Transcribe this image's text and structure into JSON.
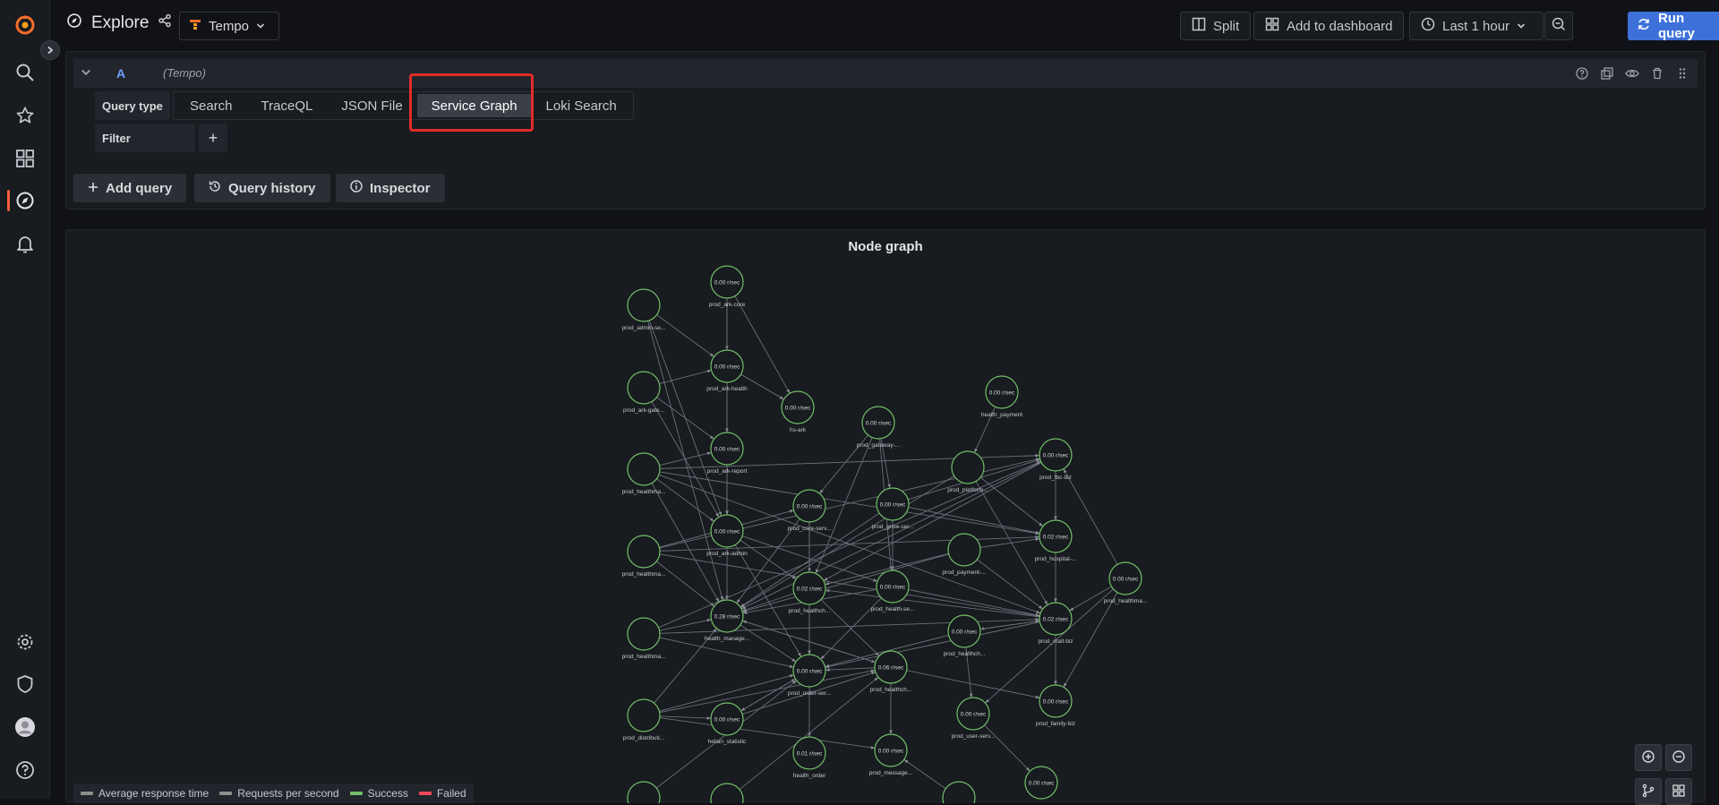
{
  "topbar": {
    "title": "Explore",
    "datasource": "Tempo",
    "split_label": "Split",
    "add_dashboard_label": "Add to dashboard",
    "time_range": "Last 1 hour",
    "run_query_label": "Run query"
  },
  "query": {
    "ref_id": "A",
    "datasource_hint": "(Tempo)",
    "query_type_label": "Query type",
    "query_types": [
      "Search",
      "TraceQL",
      "JSON File",
      "Service Graph",
      "Loki Search"
    ],
    "selected_query_type": "Service Graph",
    "filter_label": "Filter",
    "filter_add": "+",
    "buttons": {
      "add_query": "Add query",
      "query_history": "Query history",
      "inspector": "Inspector"
    }
  },
  "graph": {
    "title": "Node graph",
    "legend": [
      {
        "label": "Average response time",
        "color": "#8e8e8e"
      },
      {
        "label": "Requests per second",
        "color": "#8e8e8e"
      },
      {
        "label": "Success",
        "color": "#73bf69"
      },
      {
        "label": "Failed",
        "color": "#f2495c"
      }
    ],
    "nodes": [
      {
        "id": "n1",
        "value": "",
        "label": "prod_admin-se..."
      },
      {
        "id": "n2",
        "value": "0.00 r/sec",
        "label": "prod_ark-core"
      },
      {
        "id": "n3",
        "value": "",
        "label": "prod_ark-gate..."
      },
      {
        "id": "n4",
        "value": "0.00 r/sec",
        "label": "prod_ark-health"
      },
      {
        "id": "n5",
        "value": "0.00 r/sec",
        "label": "hs-ark"
      },
      {
        "id": "n6",
        "value": "0.00 r/sec",
        "label": "health_payment"
      },
      {
        "id": "n7",
        "value": "0.00 r/sec",
        "label": "prod_gateway-..."
      },
      {
        "id": "n8",
        "value": "0.00 r/sec",
        "label": "prod_ark-report"
      },
      {
        "id": "n9",
        "value": "",
        "label": "prod_healthma..."
      },
      {
        "id": "n10",
        "value": "",
        "label": "prod_platform..."
      },
      {
        "id": "n11",
        "value": "0.00 r/sec",
        "label": "prod_fbc-biz"
      },
      {
        "id": "n12",
        "value": "0.00 r/sec",
        "label": "prod_core-serv..."
      },
      {
        "id": "n13",
        "value": "0.00 r/sec",
        "label": "prod_grow-ser..."
      },
      {
        "id": "n14",
        "value": "0.00 r/sec",
        "label": "prod_ark-admin"
      },
      {
        "id": "n15",
        "value": "",
        "label": "prod_healthma..."
      },
      {
        "id": "n16",
        "value": "",
        "label": "prod_payment-..."
      },
      {
        "id": "n17",
        "value": "0.02 r/sec",
        "label": "prod_hospital-..."
      },
      {
        "id": "n18",
        "value": "0.00 r/sec",
        "label": "prod_healthma..."
      },
      {
        "id": "n19",
        "value": "0.02 r/sec",
        "label": "prod_healthch..."
      },
      {
        "id": "n20",
        "value": "0.00 r/sec",
        "label": "prod_health-se..."
      },
      {
        "id": "n21",
        "value": "0.28 r/sec",
        "label": "health_manage..."
      },
      {
        "id": "n22",
        "value": "0.02 r/sec",
        "label": "prod_mall-biz"
      },
      {
        "id": "n23",
        "value": "",
        "label": "prod_healthma..."
      },
      {
        "id": "n24",
        "value": "0.00 r/sec",
        "label": "prod_healthch..."
      },
      {
        "id": "n25",
        "value": "0.00 r/sec",
        "label": "prod_order-ser..."
      },
      {
        "id": "n26",
        "value": "0.06 r/sec",
        "label": "prod_healthch..."
      },
      {
        "id": "n27",
        "value": "0.00 r/sec",
        "label": "prod_family-biz"
      },
      {
        "id": "n28",
        "value": "",
        "label": "prod_distributi..."
      },
      {
        "id": "n29",
        "value": "0.00 r/sec",
        "label": "helian_statistic"
      },
      {
        "id": "n30",
        "value": "0.00 r/sec",
        "label": "prod_user-serv..."
      },
      {
        "id": "n31",
        "value": "0.01 r/sec",
        "label": "health_order"
      },
      {
        "id": "n32",
        "value": "0.00 r/sec",
        "label": "prod_message..."
      },
      {
        "id": "n33",
        "value": "0.00 r/sec",
        "label": ""
      },
      {
        "id": "n34",
        "value": "",
        "label": ""
      },
      {
        "id": "n35",
        "value": "",
        "label": ""
      },
      {
        "id": "n36",
        "value": "",
        "label": ""
      }
    ],
    "edges": [
      [
        "n1",
        "n4"
      ],
      [
        "n1",
        "n14"
      ],
      [
        "n1",
        "n21"
      ],
      [
        "n2",
        "n4"
      ],
      [
        "n2",
        "n5"
      ],
      [
        "n2",
        "n14"
      ],
      [
        "n3",
        "n4"
      ],
      [
        "n3",
        "n8"
      ],
      [
        "n3",
        "n14"
      ],
      [
        "n4",
        "n5"
      ],
      [
        "n4",
        "n8"
      ],
      [
        "n8",
        "n14"
      ],
      [
        "n9",
        "n8"
      ],
      [
        "n9",
        "n14"
      ],
      [
        "n9",
        "n11"
      ],
      [
        "n9",
        "n17"
      ],
      [
        "n9",
        "n21"
      ],
      [
        "n9",
        "n22"
      ],
      [
        "n7",
        "n12"
      ],
      [
        "n7",
        "n13"
      ],
      [
        "n7",
        "n20"
      ],
      [
        "n7",
        "n19"
      ],
      [
        "n6",
        "n10"
      ],
      [
        "n10",
        "n17"
      ],
      [
        "n10",
        "n22"
      ],
      [
        "n10",
        "n21"
      ],
      [
        "n11",
        "n17"
      ],
      [
        "n11",
        "n21"
      ],
      [
        "n12",
        "n19"
      ],
      [
        "n12",
        "n21"
      ],
      [
        "n12",
        "n25"
      ],
      [
        "n13",
        "n11"
      ],
      [
        "n13",
        "n20"
      ],
      [
        "n13",
        "n21"
      ],
      [
        "n13",
        "n17"
      ],
      [
        "n14",
        "n19"
      ],
      [
        "n14",
        "n21"
      ],
      [
        "n14",
        "n25"
      ],
      [
        "n14",
        "n20"
      ],
      [
        "n15",
        "n12"
      ],
      [
        "n15",
        "n17"
      ],
      [
        "n15",
        "n21"
      ],
      [
        "n15",
        "n22"
      ],
      [
        "n15",
        "n11"
      ],
      [
        "n16",
        "n21"
      ],
      [
        "n16",
        "n17"
      ],
      [
        "n16",
        "n22"
      ],
      [
        "n16",
        "n19"
      ],
      [
        "n17",
        "n22"
      ],
      [
        "n18",
        "n22"
      ],
      [
        "n18",
        "n11"
      ],
      [
        "n18",
        "n30"
      ],
      [
        "n19",
        "n25"
      ],
      [
        "n19",
        "n21"
      ],
      [
        "n19",
        "n26"
      ],
      [
        "n20",
        "n22"
      ],
      [
        "n20",
        "n25"
      ],
      [
        "n20",
        "n21"
      ],
      [
        "n21",
        "n25"
      ],
      [
        "n21",
        "n26"
      ],
      [
        "n22",
        "n27"
      ],
      [
        "n22",
        "n24"
      ],
      [
        "n22",
        "n25"
      ],
      [
        "n22",
        "n19"
      ],
      [
        "n23",
        "n21"
      ],
      [
        "n23",
        "n25"
      ],
      [
        "n23",
        "n22"
      ],
      [
        "n23",
        "n11"
      ],
      [
        "n24",
        "n25"
      ],
      [
        "n24",
        "n30"
      ],
      [
        "n24",
        "n22"
      ],
      [
        "n26",
        "n25"
      ],
      [
        "n26",
        "n32"
      ],
      [
        "n26",
        "n27"
      ],
      [
        "n26",
        "n21"
      ],
      [
        "n28",
        "n21"
      ],
      [
        "n28",
        "n29"
      ],
      [
        "n28",
        "n25"
      ],
      [
        "n28",
        "n26"
      ],
      [
        "n28",
        "n32"
      ],
      [
        "n29",
        "n25"
      ],
      [
        "n29",
        "n26"
      ],
      [
        "n30",
        "n33"
      ],
      [
        "n25",
        "n31"
      ],
      [
        "n25",
        "n29"
      ],
      [
        "n34",
        "n25"
      ],
      [
        "n35",
        "n26"
      ],
      [
        "n18",
        "n27"
      ],
      [
        "n36",
        "n32"
      ],
      [
        "n11",
        "n19"
      ]
    ]
  }
}
